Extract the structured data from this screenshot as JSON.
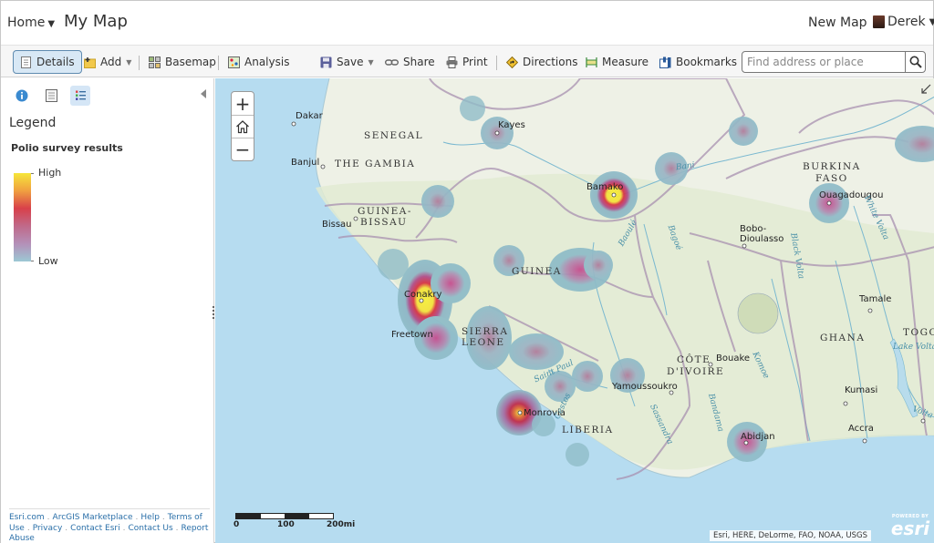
{
  "header": {
    "home_label": "Home",
    "map_title": "My Map",
    "new_map_label": "New Map",
    "user_name": "Derek"
  },
  "toolbar": {
    "details": "Details",
    "add": "Add",
    "basemap": "Basemap",
    "analysis": "Analysis",
    "save": "Save",
    "share": "Share",
    "print": "Print",
    "directions": "Directions",
    "measure": "Measure",
    "bookmarks": "Bookmarks",
    "search_placeholder": "Find address or place",
    "search_value": ""
  },
  "sidebar": {
    "tabs": [
      {
        "name": "about",
        "icon": "info-icon",
        "active": false
      },
      {
        "name": "content",
        "icon": "content-icon",
        "active": false
      },
      {
        "name": "legend",
        "icon": "legend-icon",
        "active": true
      }
    ],
    "legend_title": "Legend",
    "layer_title": "Polio survey results",
    "ramp_high": "High",
    "ramp_low": "Low",
    "ramp_colors": [
      "#f6e63a",
      "#f0a040",
      "#d8404a",
      "#c06a8a",
      "#b490b8",
      "#9cc8d4"
    ],
    "footer_links": [
      "Esri.com",
      "ArcGIS Marketplace",
      "Help",
      "Terms of Use",
      "Privacy",
      "Contact Esri",
      "Contact Us",
      "Report Abuse"
    ]
  },
  "map": {
    "countries": [
      "SENEGAL",
      "THE GAMBIA",
      "GUINEA-",
      "BISSAU",
      "GUINEA",
      "SIERRA",
      "LEONE",
      "LIBERIA",
      "CÔTE",
      "D'IVOIRE",
      "BURKINA",
      "FASO",
      "GHANA",
      "TOGO"
    ],
    "cities": [
      "Dakar",
      "Banjul",
      "Bissau",
      "Kayes",
      "Bamako",
      "Conakry",
      "Freetown",
      "Monrovia",
      "Yamoussoukro",
      "Bouake",
      "Abidjan",
      "Ouagadougou",
      "Bobo-",
      "Dioulasso",
      "Tamale",
      "Kumasi",
      "Accra"
    ],
    "rivers": [
      "Bani",
      "Baoulé",
      "Bagoé",
      "Saint Paul",
      "Cestos",
      "Sassandra",
      "Bandama",
      "Komoe",
      "Black Volta",
      "White Volta",
      "Lake Volta",
      "Volta"
    ],
    "scale_labels": [
      "0",
      "100",
      "200mi"
    ],
    "attribution": "Esri, HERE, DeLorme, FAO, NOAA, USGS",
    "logo_powered": "POWERED BY",
    "logo_name": "esri"
  }
}
